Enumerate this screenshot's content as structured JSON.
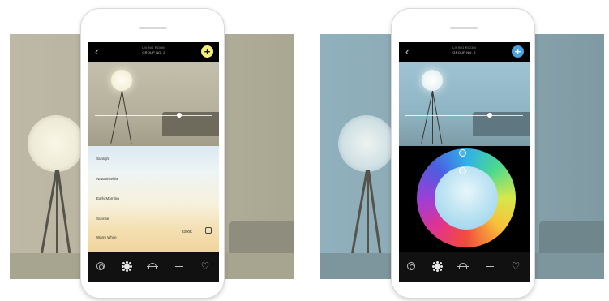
{
  "left_phone": {
    "header": {
      "back_icon": "chevron-left-icon",
      "title": "LIVING ROOM",
      "subtitle": "GROUP NO. 2",
      "add_icon": "plus-icon",
      "add_color": "#f1ee7a"
    },
    "brightness": 0.72,
    "presets": [
      "Sunlight",
      "Natural White",
      "Early Morning",
      "Sunrise",
      "Warm White"
    ],
    "kelvin": "3300K",
    "tabs": [
      "target-icon",
      "sun-icon",
      "bulb-icon",
      "sliders-icon",
      "heart-icon"
    ]
  },
  "right_phone": {
    "header": {
      "back_icon": "chevron-left-icon",
      "title": "LIVING ROOM",
      "subtitle": "GROUP NO. 2",
      "add_icon": "plus-icon",
      "add_color": "#4aa3df"
    },
    "brightness": 0.72,
    "tabs": [
      "target-icon",
      "sun-icon",
      "bulb-icon",
      "sliders-icon",
      "heart-icon"
    ]
  }
}
